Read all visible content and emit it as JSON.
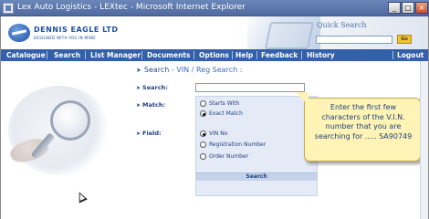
{
  "window": {
    "title": "Lex Auto Logistics - LEXtec - Microsoft Internet Explorer",
    "buttons": [
      "_",
      "□",
      "×"
    ]
  },
  "header": {
    "logo_name": "DENNIS EAGLE LTD",
    "logo_tagline": "DESIGNED WITH YOU IN MIND",
    "quick_search_label": "Quick Search",
    "quick_search_value": "",
    "go_label": "Go"
  },
  "nav": {
    "items": [
      "Catalogue",
      "Search",
      "List Manager",
      "Documents",
      "Options",
      "Help",
      "Feedback",
      "History"
    ],
    "logout": "Logout"
  },
  "form": {
    "title_prefix": "Search - ",
    "title_sub": "VIN / Reg Search :",
    "search_label": "Search:",
    "match_label": "Match:",
    "field_label": "Field:",
    "match_options": [
      "Starts With",
      "Exact Match"
    ],
    "match_selected": "Exact Match",
    "field_options": [
      "VIN No",
      "Registration Number",
      "Order Number"
    ],
    "field_selected": "VIN No",
    "search_button": "Search"
  },
  "tooltip": {
    "text": "Enter the first few characters of the V.I.N. number that you are searching for ..... SA90749"
  },
  "icons": {
    "bullet": "arrow-bullet-icon",
    "cursor": "mouse-pointer-icon"
  },
  "colors": {
    "nav_bg": "#3360a8",
    "tooltip_bg": "#fff4b5",
    "panel_bg": "#e4ebf6",
    "go_button": "#f2c230"
  }
}
